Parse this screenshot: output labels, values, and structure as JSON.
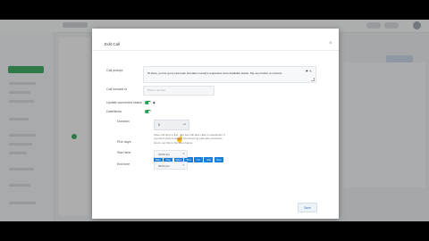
{
  "modal": {
    "title": "Edit Call",
    "close_glyph": "×"
  },
  "fields": {
    "call_prompt_label": "Call prompt",
    "call_prompt_text_before": "Hi there, you've got a new lead. [Location name]'s requested more ",
    "call_prompt_link": "Available",
    "call_prompt_text_after": " status. Tap any button to connect.",
    "call_forward_label": "Call forward to",
    "call_forward_placeholder": "Phone number",
    "update_label": "Update connected status",
    "date_times_label": "Date/times",
    "duration_label": "Duration",
    "duration_value": "5",
    "help_text": "Save call time to live. You can still take calls on weekends. If you don't want to accept the incoming calls after business hours, set this to the ones below.",
    "pick_days_label": "Pick days",
    "days": [
      "Mon",
      "Tue",
      "Wed",
      "Thu",
      "Fri",
      "Sat",
      "Sun"
    ],
    "start_label": "Start time",
    "start_value": "09:00 am",
    "end_label": "End time",
    "end_value": "05:00 pm"
  },
  "actions": {
    "save_label": "Save"
  },
  "colors": {
    "toggle_on": "#2f9f53",
    "day_selected": "#1b7fd9"
  }
}
